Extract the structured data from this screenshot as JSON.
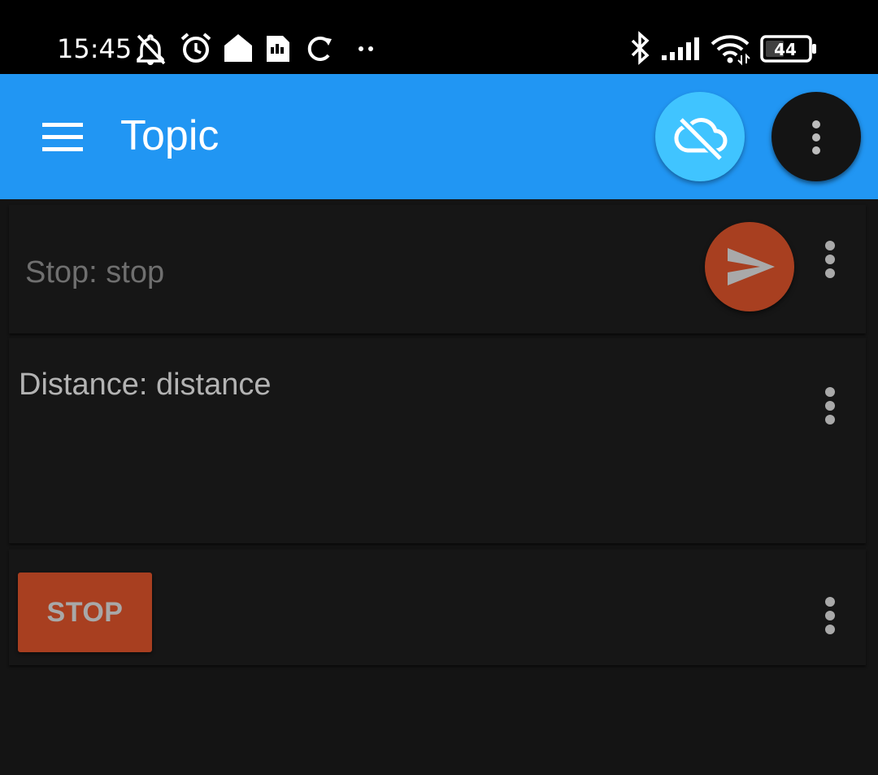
{
  "status_bar": {
    "time": "15:45",
    "battery": "44",
    "icons": [
      "mute-icon",
      "alarm-icon",
      "home-icon",
      "sd-card-icon",
      "sync-icon",
      "more-dots-icon",
      "bluetooth-icon",
      "signal-icon",
      "wifi-icon",
      "battery-icon"
    ]
  },
  "app_bar": {
    "title": "Topic",
    "menu_icon": "hamburger-menu-icon",
    "cloud_icon": "cloud-off-icon",
    "overflow_icon": "more-vert-icon"
  },
  "cards": [
    {
      "label": "Stop: stop",
      "action_icon": "send-icon",
      "menu_icon": "more-vert-icon"
    },
    {
      "label": "Distance: distance",
      "menu_icon": "more-vert-icon"
    },
    {
      "button_label": "STOP",
      "menu_icon": "more-vert-icon"
    }
  ],
  "colors": {
    "status_bar": "#000000",
    "app_bar": "#2196f3",
    "cloud_button": "#40c4ff",
    "accent": "#a83f20",
    "background": "#141414",
    "card": "#161616"
  }
}
